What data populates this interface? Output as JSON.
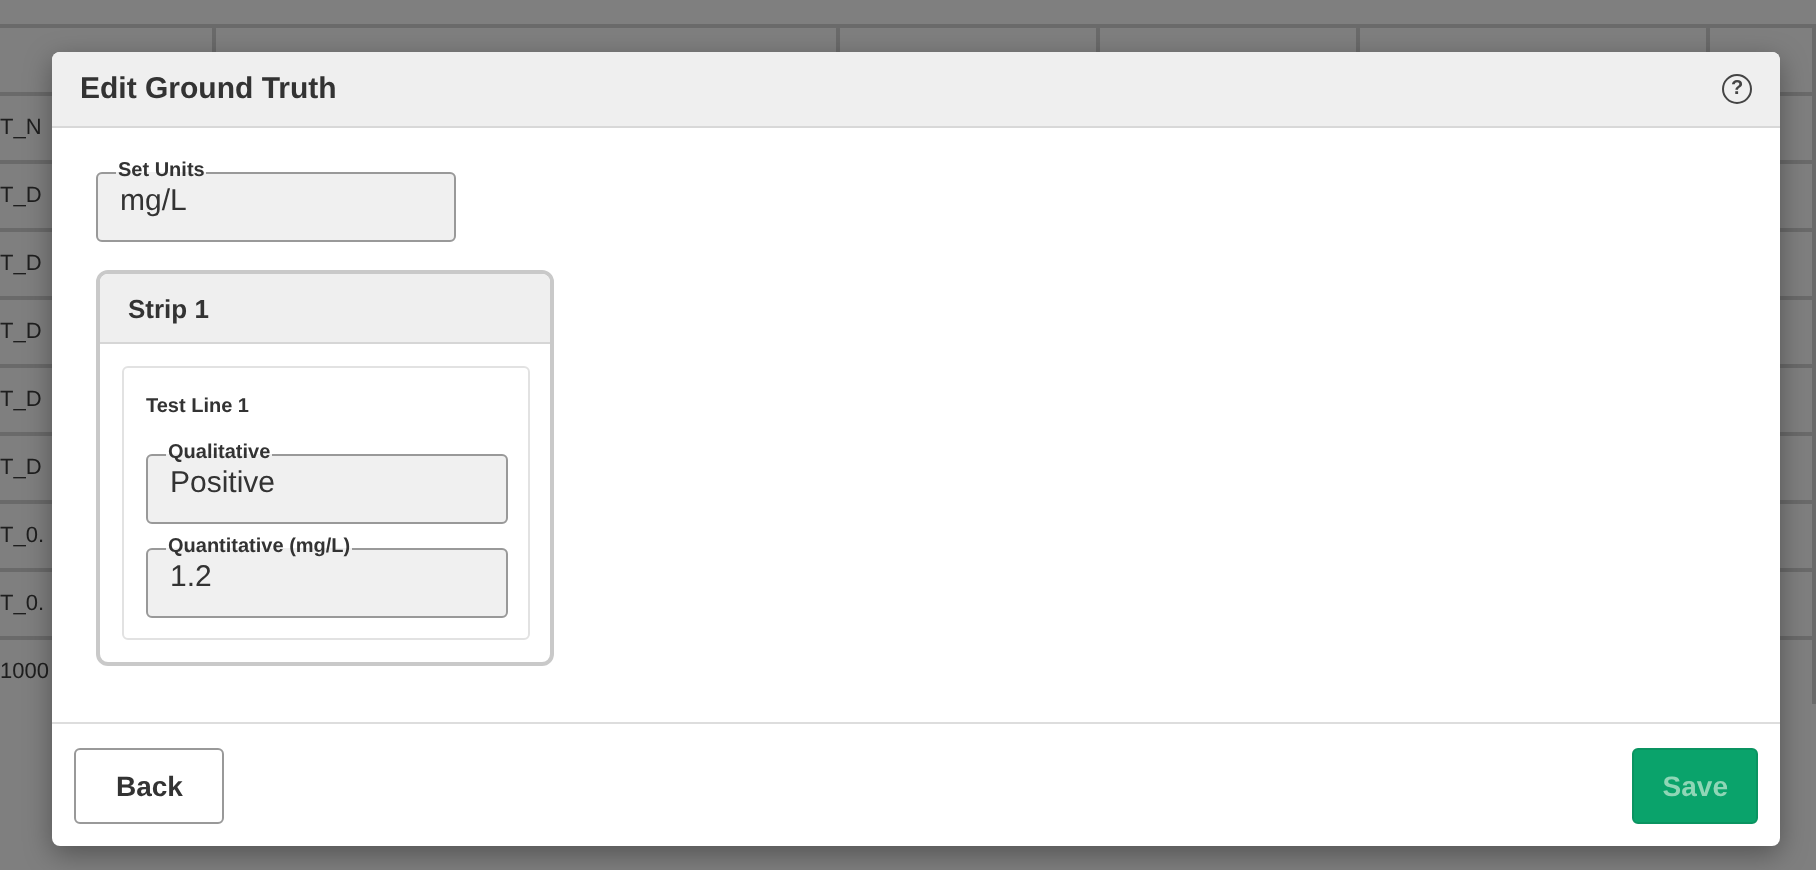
{
  "background_table": {
    "rows": [
      {
        "column_1": ""
      },
      {
        "column_1": "T_N"
      },
      {
        "column_1": "T_D"
      },
      {
        "column_1": "T_D"
      },
      {
        "column_1": "T_D"
      },
      {
        "column_1": "T_D"
      },
      {
        "column_1": "T_D"
      },
      {
        "column_1": "T_0."
      },
      {
        "column_1": "T_0."
      },
      {
        "column_1": "1000"
      }
    ]
  },
  "dialog": {
    "title": "Edit Ground Truth",
    "help": "?",
    "units": {
      "label": "Set Units",
      "value": "mg/L"
    },
    "strips": [
      {
        "title": "Strip 1",
        "test_lines": [
          {
            "title": "Test Line 1",
            "fields": [
              {
                "label": "Qualitative",
                "value": "Positive"
              },
              {
                "label": "Quantitative (mg/L)",
                "value": "1.2"
              }
            ]
          }
        ]
      }
    ],
    "buttons": [
      {
        "label": "Back",
        "kind": "secondary",
        "disabled": false
      },
      {
        "label": "Save",
        "kind": "primary",
        "disabled": true
      }
    ]
  }
}
